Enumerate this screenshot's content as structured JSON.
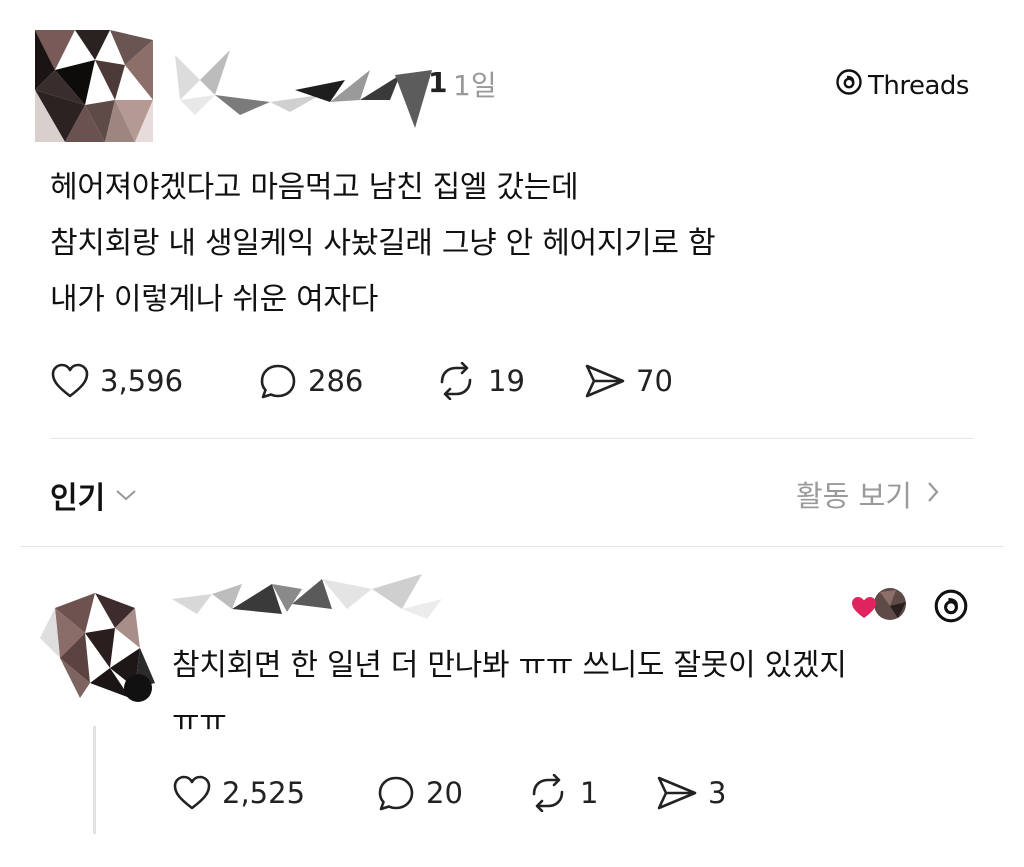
{
  "post": {
    "author_suffix": "1",
    "time": "1일",
    "brand_label": "Threads",
    "brand_icon": "threads-logo-icon",
    "lines": [
      "헤어져야겠다고 마음먹고 남친 집엘 갔는데",
      "참치회랑 내 생일케익 사놨길래 그냥 안 헤어지기로 함",
      "내가 이렇게나 쉬운 여자다"
    ],
    "stats": {
      "likes": "3,596",
      "comments": "286",
      "reposts": "19",
      "shares": "70"
    }
  },
  "sort_bar": {
    "label": "인기",
    "activity_label": "활동 보기"
  },
  "reply": {
    "lines": [
      "참치회면 한 일년 더 만나봐 ㅠㅠ 쓰니도 잘못이 있겠지",
      "ㅠㅠ"
    ],
    "badge_icon": "liked-by-author-heart-icon",
    "stats": {
      "likes": "2,525",
      "comments": "20",
      "reposts": "1",
      "shares": "3"
    }
  },
  "colors": {
    "text": "#111111",
    "muted": "#999999",
    "heart": "#e0245e",
    "divider": "#e6e6e6"
  }
}
